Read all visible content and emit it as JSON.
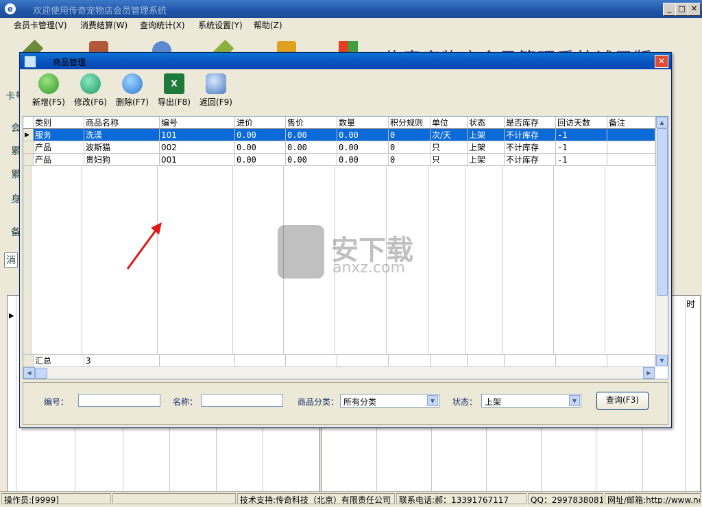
{
  "main_window": {
    "title": "欢迎使用传奇宠物店会员管理系统",
    "min_glyph": "_",
    "max_glyph": "□",
    "close_glyph": "✕"
  },
  "menu": [
    "会员卡管理(V)",
    "消费结算(W)",
    "查询统计(X)",
    "系统设置(Y)",
    "帮助(Z)"
  ],
  "background": {
    "heading": "传奇宠物店会员管理系统试用版",
    "left_labels": [
      "卡号",
      "会",
      "累",
      "累",
      "身",
      "备",
      "消"
    ],
    "right_header": "时"
  },
  "dialog": {
    "title": "商品管理",
    "toolbar": [
      {
        "label": "新增(F5)",
        "icon": "add-icon",
        "color": "#2e9a2e"
      },
      {
        "label": "修改(F6)",
        "icon": "edit-icon",
        "color": "#1e9a6a"
      },
      {
        "label": "删除(F7)",
        "icon": "delete-icon",
        "color": "#2c7bd0"
      },
      {
        "label": "导出(F8)",
        "icon": "excel-icon",
        "color": "#1d7a3a"
      },
      {
        "label": "返回(F9)",
        "icon": "return-icon",
        "color": "#4a7cc0"
      }
    ],
    "grid": {
      "columns": [
        "类别",
        "商品名称",
        "编号",
        "进价",
        "售价",
        "数量",
        "积分规则",
        "单位",
        "状态",
        "是否库存",
        "回访天数",
        "备注"
      ],
      "rows": [
        [
          "服务",
          "洗澡",
          "101",
          "0.00",
          "0.00",
          "0.00",
          "0",
          "次/天",
          "上架",
          "不计库存",
          "-1",
          ""
        ],
        [
          "产品",
          "波斯猫",
          "002",
          "0.00",
          "0.00",
          "0.00",
          "0",
          "只",
          "上架",
          "不计库存",
          "-1",
          ""
        ],
        [
          "产品",
          "贵妇狗",
          "001",
          "0.00",
          "0.00",
          "0.00",
          "0",
          "只",
          "上架",
          "不计库存",
          "-1",
          ""
        ]
      ],
      "selected_row": 0,
      "summary_label": "汇总",
      "summary_count": "3"
    },
    "filter": {
      "code_label": "编号：",
      "code_value": "",
      "name_label": "名称：",
      "name_value": "",
      "category_label": "商品分类：",
      "category_value": "所有分类",
      "status_label": "状态：",
      "status_value": "上架",
      "query_button": "查询(F3)"
    }
  },
  "statusbar": {
    "operator": "操作员:[9999]",
    "support": "技术支持:传奇科技（北京）有限责任公司",
    "phone": "联系电话:郝：13391767117",
    "qq": "QQ：2997838081",
    "web": "网址/邮箱:http://www.ne"
  },
  "watermark": {
    "line1": "安下载",
    "line2": "anxz.com"
  }
}
